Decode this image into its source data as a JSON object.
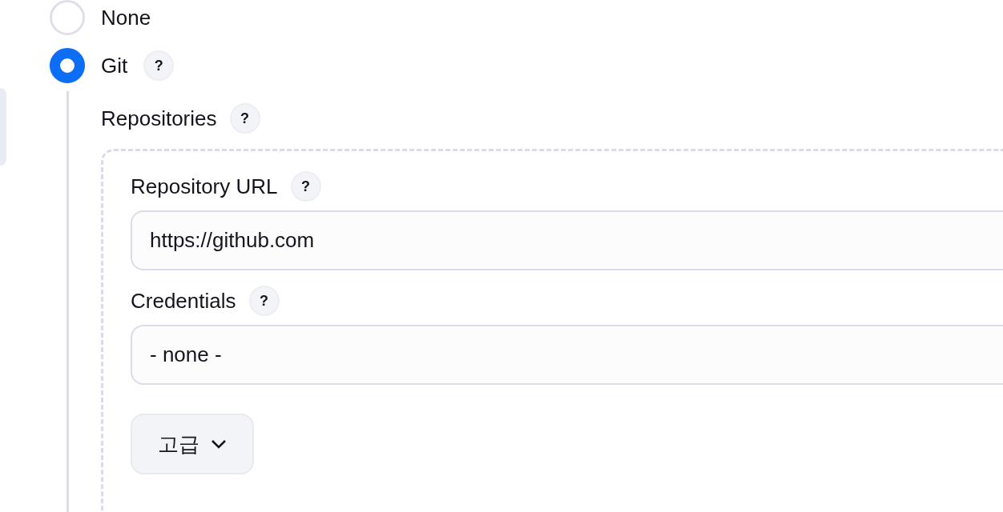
{
  "scm_options": [
    {
      "label": "None",
      "selected": false
    },
    {
      "label": "Git",
      "selected": true,
      "help": "?"
    }
  ],
  "repositories": {
    "label": "Repositories",
    "help": "?",
    "fields": [
      {
        "label": "Repository URL",
        "help": "?",
        "value": "https://github.com"
      },
      {
        "label": "Credentials",
        "help": "?",
        "value": "- none -"
      }
    ],
    "advanced_button": {
      "label": "고급"
    }
  }
}
